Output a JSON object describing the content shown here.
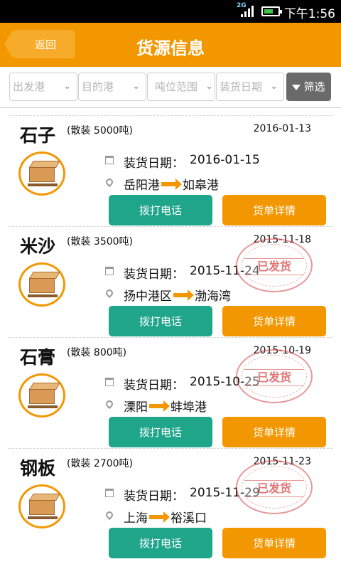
{
  "status_bar": {
    "network": "2G",
    "time": "下午1:56"
  },
  "header": {
    "back_label": "返回",
    "title": "货源信息"
  },
  "filters": {
    "origin_port": "出发港",
    "destination_port": "目的港",
    "tonnage_range": "吨位范围",
    "loading_date": "装货日期",
    "filter_button": "筛选"
  },
  "labels": {
    "load_date_label": "装货日期：",
    "call_button": "拨打电话",
    "detail_button": "货单详情",
    "shipped_stamp": "已发货"
  },
  "colors": {
    "brand_orange": "#f39700",
    "call_green": "#1ea58a",
    "stamp_red": "#d64646"
  },
  "cargo_list": [
    {
      "name": "石子",
      "spec": "(散装  5000吨)",
      "date": "2016-01-13",
      "load_date": "2016-01-15",
      "from": "岳阳港",
      "to": "如皋港",
      "shipped": false
    },
    {
      "name": "米沙",
      "spec": "(散装  3500吨)",
      "date": "2015-11-18",
      "load_date": "2015-11-24",
      "from": "扬中港区",
      "to": "渤海湾",
      "shipped": true
    },
    {
      "name": "石膏",
      "spec": "(散装  800吨)",
      "date": "2015-10-19",
      "load_date": "2015-10-25",
      "from": "溧阳",
      "to": "蚌埠港",
      "shipped": true
    },
    {
      "name": "钢板",
      "spec": "(散装  2700吨)",
      "date": "2015-11-23",
      "load_date": "2015-11-29",
      "from": "上海",
      "to": "裕溪口",
      "shipped": true
    }
  ]
}
